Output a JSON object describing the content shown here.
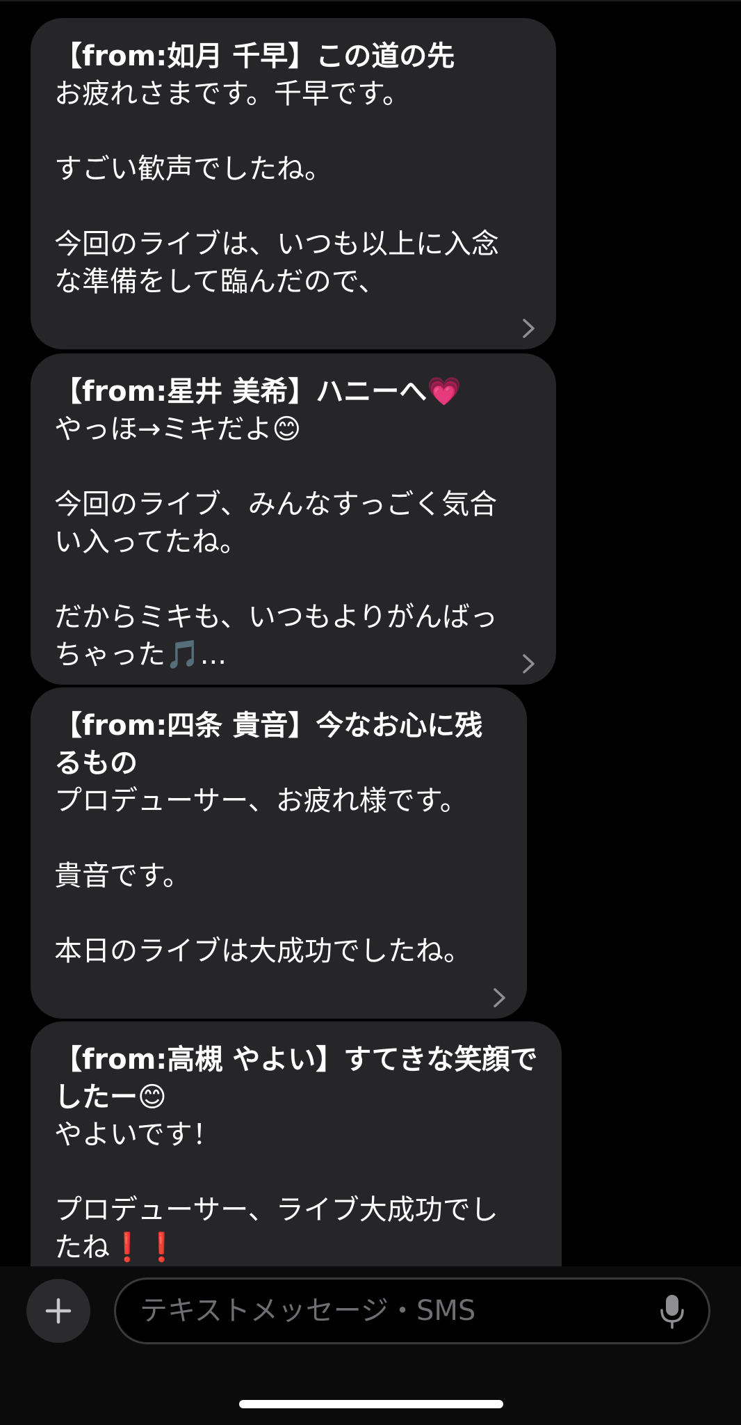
{
  "messages": [
    {
      "title": "【from:如月 千早】この道の先",
      "body": "お疲れさまです。千早です。\n\nすごい歓声でしたね。\n\n今回のライブは、いつも以上に入念\nな準備をして臨んだので、"
    },
    {
      "title": "【from:星井 美希】ハニーへ💗",
      "body": "やっほ→ミキだよ😊\n\n今回のライブ、みんなすっごく気合\nい入ってたね。\n\nだからミキも、いつもよりがんばっ\nちゃった🎵..."
    },
    {
      "title": "【from:四条 貴音】今なお心に残\nるもの",
      "body": "プロデューサー、お疲れ様です。\n\n貴音です。\n\n本日のライブは大成功でしたね。"
    },
    {
      "title": "【from:高槻 やよい】すてきな笑顔で\nしたー😊",
      "body": "やよいです！\n\nプロデューサー、ライブ大成功でし\nたね❗❗"
    }
  ],
  "composer": {
    "placeholder": "テキストメッセージ・SMS"
  },
  "icons": {
    "add": "plus-icon",
    "mic": "microphone-icon",
    "more": "chevron-right-icon"
  }
}
